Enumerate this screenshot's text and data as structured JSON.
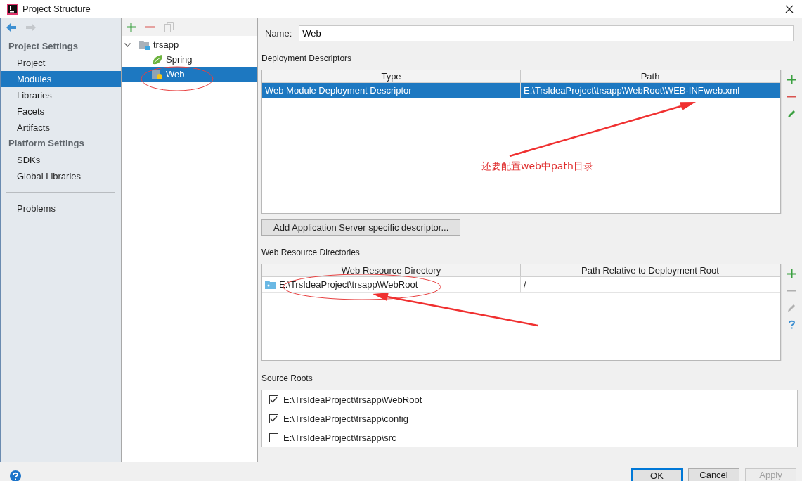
{
  "window": {
    "title": "Project Structure"
  },
  "sidebar": {
    "sections": [
      {
        "heading": "Project Settings",
        "items": [
          {
            "label": "Project",
            "selected": false
          },
          {
            "label": "Modules",
            "selected": true
          },
          {
            "label": "Libraries",
            "selected": false
          },
          {
            "label": "Facets",
            "selected": false
          },
          {
            "label": "Artifacts",
            "selected": false
          }
        ]
      },
      {
        "heading": "Platform Settings",
        "items": [
          {
            "label": "SDKs",
            "selected": false
          },
          {
            "label": "Global Libraries",
            "selected": false
          }
        ]
      }
    ],
    "bottom_items": [
      {
        "label": "Problems",
        "selected": false
      }
    ]
  },
  "tree": [
    {
      "label": "trsapp",
      "kind": "module",
      "expanded": true,
      "selected": false,
      "children": [
        {
          "label": "Spring",
          "kind": "spring",
          "selected": false
        },
        {
          "label": "Web",
          "kind": "web",
          "selected": true
        }
      ]
    }
  ],
  "name_field": {
    "label": "Name:",
    "value": "Web"
  },
  "deployment_descriptors": {
    "title": "Deployment Descriptors",
    "columns": [
      "Type",
      "Path"
    ],
    "rows": [
      {
        "cells": [
          "Web Module Deployment Descriptor",
          "E:\\TrsIdeaProject\\trsapp\\WebRoot\\WEB-INF\\web.xml"
        ],
        "selected": true
      }
    ],
    "tools": [
      {
        "kind": "add",
        "disabled": false
      },
      {
        "kind": "remove",
        "disabled": false
      },
      {
        "kind": "edit",
        "disabled": false
      }
    ]
  },
  "add_descriptor_button": "Add Application Server specific descriptor...",
  "web_resource_directories": {
    "title": "Web Resource Directories",
    "columns": [
      "Web Resource Directory",
      "Path Relative to Deployment Root"
    ],
    "rows": [
      {
        "cells": [
          "E:\\TrsIdeaProject\\trsapp\\WebRoot",
          "/"
        ],
        "selected": false
      }
    ],
    "tools": [
      {
        "kind": "add",
        "disabled": false
      },
      {
        "kind": "remove",
        "disabled": true
      },
      {
        "kind": "edit",
        "disabled": true
      },
      {
        "kind": "help",
        "disabled": false
      }
    ]
  },
  "source_roots": {
    "title": "Source Roots",
    "items": [
      {
        "path": "E:\\TrsIdeaProject\\trsapp\\WebRoot",
        "checked": true
      },
      {
        "path": "E:\\TrsIdeaProject\\trsapp\\config",
        "checked": true
      },
      {
        "path": "E:\\TrsIdeaProject\\trsapp\\src",
        "checked": false
      }
    ]
  },
  "buttons": [
    {
      "label": "OK",
      "default": true,
      "disabled": false
    },
    {
      "label": "Cancel",
      "default": false,
      "disabled": false
    },
    {
      "label": "Apply",
      "default": false,
      "disabled": true
    }
  ],
  "annotation": {
    "text": "还要配置web中path目录"
  }
}
